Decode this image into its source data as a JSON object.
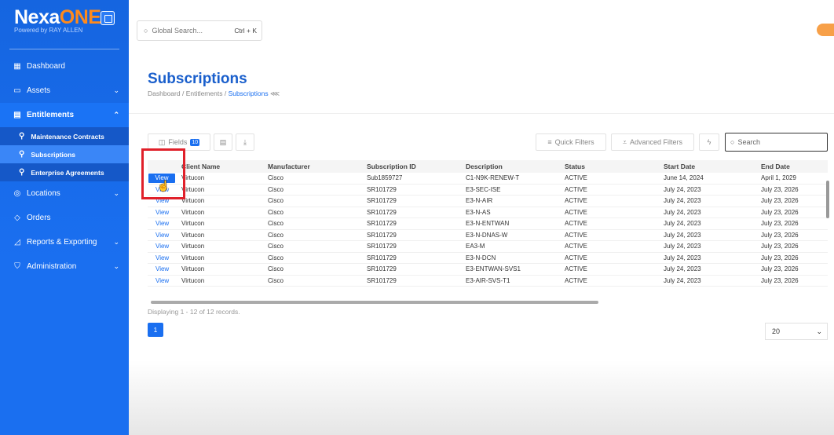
{
  "brand": {
    "name_part1": "Nexa",
    "name_part2": "ONE",
    "tagline": "Powered by RAY ALLEN"
  },
  "global_search": {
    "placeholder": "Global Search...",
    "shortcut": "Ctrl + K"
  },
  "sidebar": {
    "items": [
      {
        "label": "Dashboard",
        "icon": "grid-icon"
      },
      {
        "label": "Assets",
        "icon": "monitor-icon"
      },
      {
        "label": "Entitlements",
        "icon": "document-icon"
      },
      {
        "label": "Locations",
        "icon": "pin-icon"
      },
      {
        "label": "Orders",
        "icon": "tag-icon"
      },
      {
        "label": "Reports & Exporting",
        "icon": "chart-icon"
      },
      {
        "label": "Administration",
        "icon": "shield-icon"
      }
    ],
    "sub_items": [
      {
        "label": "Maintenance Contracts"
      },
      {
        "label": "Subscriptions"
      },
      {
        "label": "Enterprise Agreements"
      }
    ]
  },
  "page": {
    "title": "Subscriptions",
    "breadcrumb": {
      "part1": "Dashboard",
      "part2": "Entitlements",
      "current": "Subscriptions"
    }
  },
  "toolbar": {
    "fields_label": "Fields",
    "fields_count": "10",
    "quick_filters": "Quick Filters",
    "advanced_filters": "Advanced Filters",
    "search_placeholder": "Search"
  },
  "table": {
    "columns": [
      "",
      "Client Name",
      "Manufacturer",
      "Subscription ID",
      "Description",
      "Status",
      "Start Date",
      "End Date"
    ],
    "view_label": "View",
    "rows": [
      {
        "client": "Virtucon",
        "manufacturer": "Cisco",
        "id": "Sub1859727",
        "description": "C1-N9K-RENEW-T",
        "status": "ACTIVE",
        "start": "June 14, 2024",
        "end": "April 1, 2029"
      },
      {
        "client": "Virtucon",
        "manufacturer": "Cisco",
        "id": "SR101729",
        "description": "E3-SEC-ISE",
        "status": "ACTIVE",
        "start": "July 24, 2023",
        "end": "July 23, 2026"
      },
      {
        "client": "Virtucon",
        "manufacturer": "Cisco",
        "id": "SR101729",
        "description": "E3-N-AIR",
        "status": "ACTIVE",
        "start": "July 24, 2023",
        "end": "July 23, 2026"
      },
      {
        "client": "Virtucon",
        "manufacturer": "Cisco",
        "id": "SR101729",
        "description": "E3-N-AS",
        "status": "ACTIVE",
        "start": "July 24, 2023",
        "end": "July 23, 2026"
      },
      {
        "client": "Virtucon",
        "manufacturer": "Cisco",
        "id": "SR101729",
        "description": "E3-N-ENTWAN",
        "status": "ACTIVE",
        "start": "July 24, 2023",
        "end": "July 23, 2026"
      },
      {
        "client": "Virtucon",
        "manufacturer": "Cisco",
        "id": "SR101729",
        "description": "E3-N-DNAS-W",
        "status": "ACTIVE",
        "start": "July 24, 2023",
        "end": "July 23, 2026"
      },
      {
        "client": "Virtucon",
        "manufacturer": "Cisco",
        "id": "SR101729",
        "description": "EA3-M",
        "status": "ACTIVE",
        "start": "July 24, 2023",
        "end": "July 23, 2026"
      },
      {
        "client": "Virtucon",
        "manufacturer": "Cisco",
        "id": "SR101729",
        "description": "E3-N-DCN",
        "status": "ACTIVE",
        "start": "July 24, 2023",
        "end": "July 23, 2026"
      },
      {
        "client": "Virtucon",
        "manufacturer": "Cisco",
        "id": "SR101729",
        "description": "E3-ENTWAN-SVS1",
        "status": "ACTIVE",
        "start": "July 24, 2023",
        "end": "July 23, 2026"
      },
      {
        "client": "Virtucon",
        "manufacturer": "Cisco",
        "id": "SR101729",
        "description": "E3-AIR-SVS-T1",
        "status": "ACTIVE",
        "start": "July 24, 2023",
        "end": "July 23, 2026"
      }
    ]
  },
  "pagination": {
    "summary": "Displaying 1 - 12 of 12 records.",
    "current_page": "1",
    "page_size": "20"
  },
  "colors": {
    "primary": "#1a6ff0",
    "sidebar": "#1565e0",
    "highlight": "#e0202a",
    "accent": "#ff8a1c"
  }
}
